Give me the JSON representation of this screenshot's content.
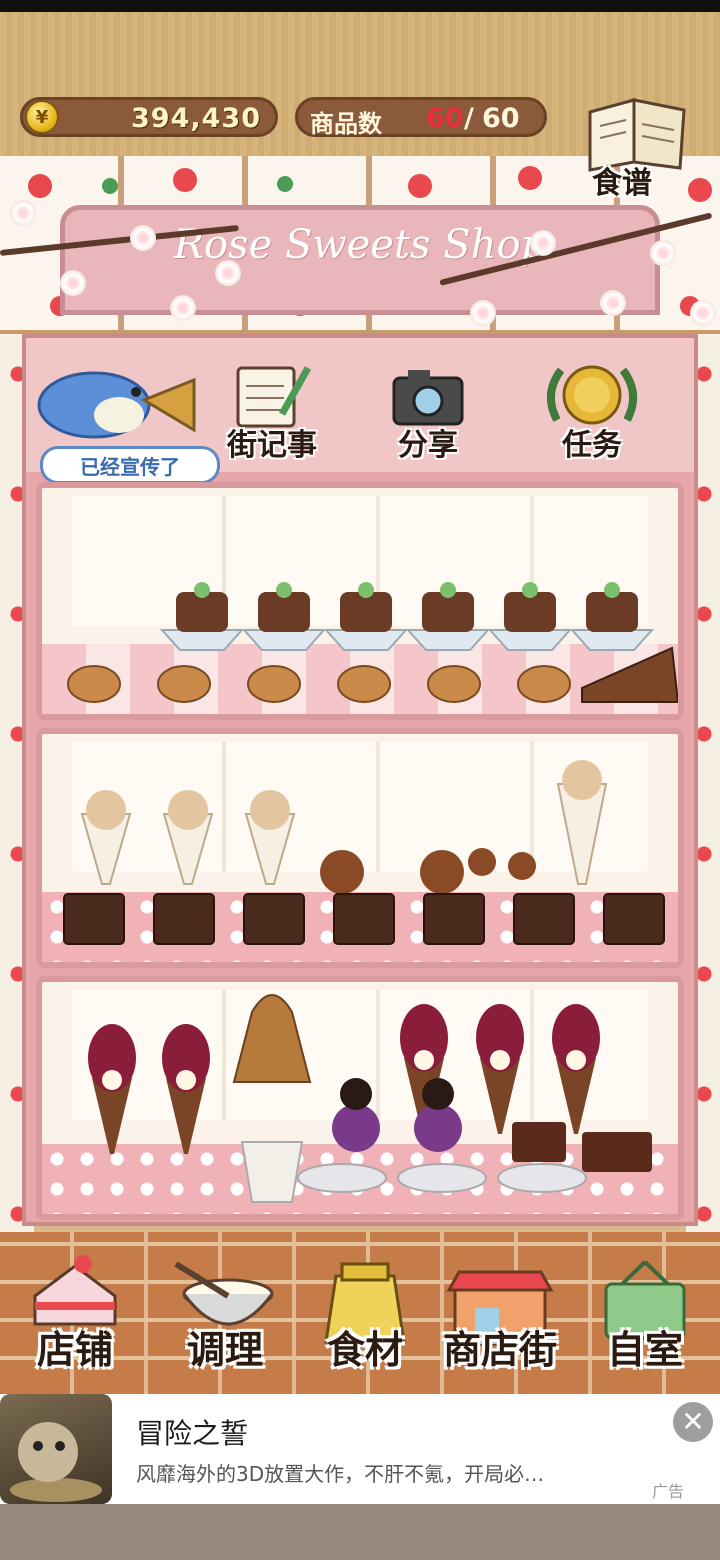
{
  "header": {
    "coins": "394,430",
    "coin_symbol": "¥",
    "product_count_label": "商品数",
    "product_count_current": "60",
    "product_count_separator": "/",
    "product_count_max": "60",
    "recipe_label": "食谱"
  },
  "shop": {
    "sign_text": "Rose Sweets Shop"
  },
  "menu": {
    "promo_badge": "已经宣传了",
    "items": [
      {
        "label": "街记事",
        "icon": "notepad-icon"
      },
      {
        "label": "分享",
        "icon": "camera-icon"
      },
      {
        "label": "任务",
        "icon": "laurel-medal-icon"
      }
    ]
  },
  "bottom_nav": {
    "items": [
      {
        "label": "店铺",
        "icon": "cake-icon"
      },
      {
        "label": "调理",
        "icon": "mixing-bowl-icon"
      },
      {
        "label": "食材",
        "icon": "ingredient-bag-icon"
      },
      {
        "label": "商店街",
        "icon": "storefront-icon"
      },
      {
        "label": "自室",
        "icon": "staff-only-sign-icon"
      }
    ]
  },
  "ad": {
    "title": "冒险之誓",
    "description": "风靡海外的3D放置大作，不肝不氪，开局必…",
    "tag": "广告",
    "close_symbol": "✕"
  },
  "colors": {
    "accent_red": "#e83040",
    "pill_brown": "#8a5a3a",
    "shelf_pink": "#e7a7aa"
  }
}
